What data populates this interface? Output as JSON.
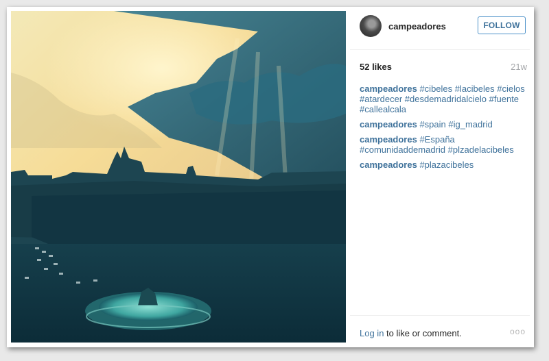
{
  "post": {
    "username": "campeadores",
    "follow_label": "FOLLOW",
    "likes": "52 likes",
    "time_ago": "21w",
    "comments": [
      {
        "user": "campeadores",
        "tags": [
          "#cibeles",
          "#lacibeles",
          "#cielos",
          "#atardecer",
          "#desdemadridalcielo",
          "#fuente",
          "#callealcala"
        ]
      },
      {
        "user": "campeadores",
        "tags": [
          "#spain",
          "#ig_madrid"
        ]
      },
      {
        "user": "campeadores",
        "tags": [
          "#España",
          "#comunidaddemadrid",
          "#plzadelacibeles"
        ]
      },
      {
        "user": "campeadores",
        "tags": [
          "#plazacibeles"
        ]
      }
    ],
    "login_link": "Log in",
    "login_rest": " to like or comment.",
    "more_icon": "ooo"
  },
  "colors": {
    "link_blue": "#3f729b",
    "follow_border": "#4a90c8",
    "muted": "#a5a7aa"
  }
}
